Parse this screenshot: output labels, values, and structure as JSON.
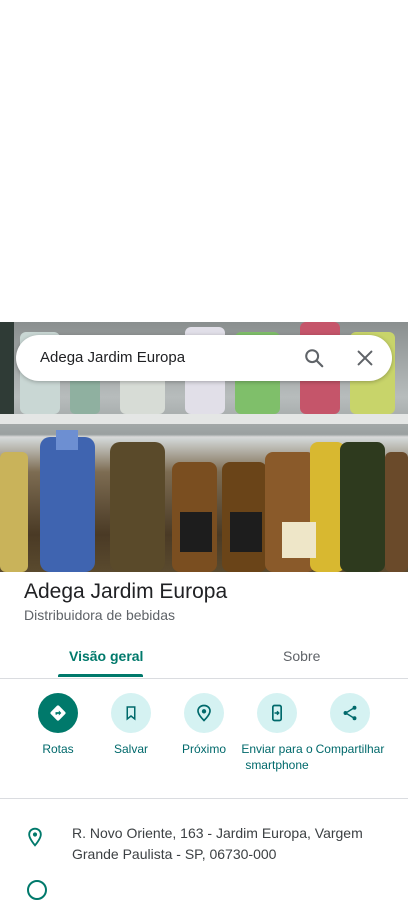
{
  "search": {
    "query": "Adega Jardim Europa"
  },
  "place": {
    "name": "Adega Jardim Europa",
    "category": "Distribuidora de bebidas"
  },
  "tabs": [
    {
      "label": "Visão geral",
      "active": true
    },
    {
      "label": "Sobre",
      "active": false
    }
  ],
  "actions": [
    {
      "label": "Rotas",
      "icon": "directions-icon"
    },
    {
      "label": "Salvar",
      "icon": "bookmark-icon"
    },
    {
      "label": "Próximo",
      "icon": "nearby-icon"
    },
    {
      "label": "Enviar para o smartphone",
      "icon": "send-to-phone-icon"
    },
    {
      "label": "Compartilhar",
      "icon": "share-icon"
    }
  ],
  "address": "R. Novo Oriente, 163 - Jardim Europa, Vargem Grande Paulista - SP, 06730-000",
  "colors": {
    "accent": "#00796b",
    "action_bg": "#d5f2f2"
  }
}
